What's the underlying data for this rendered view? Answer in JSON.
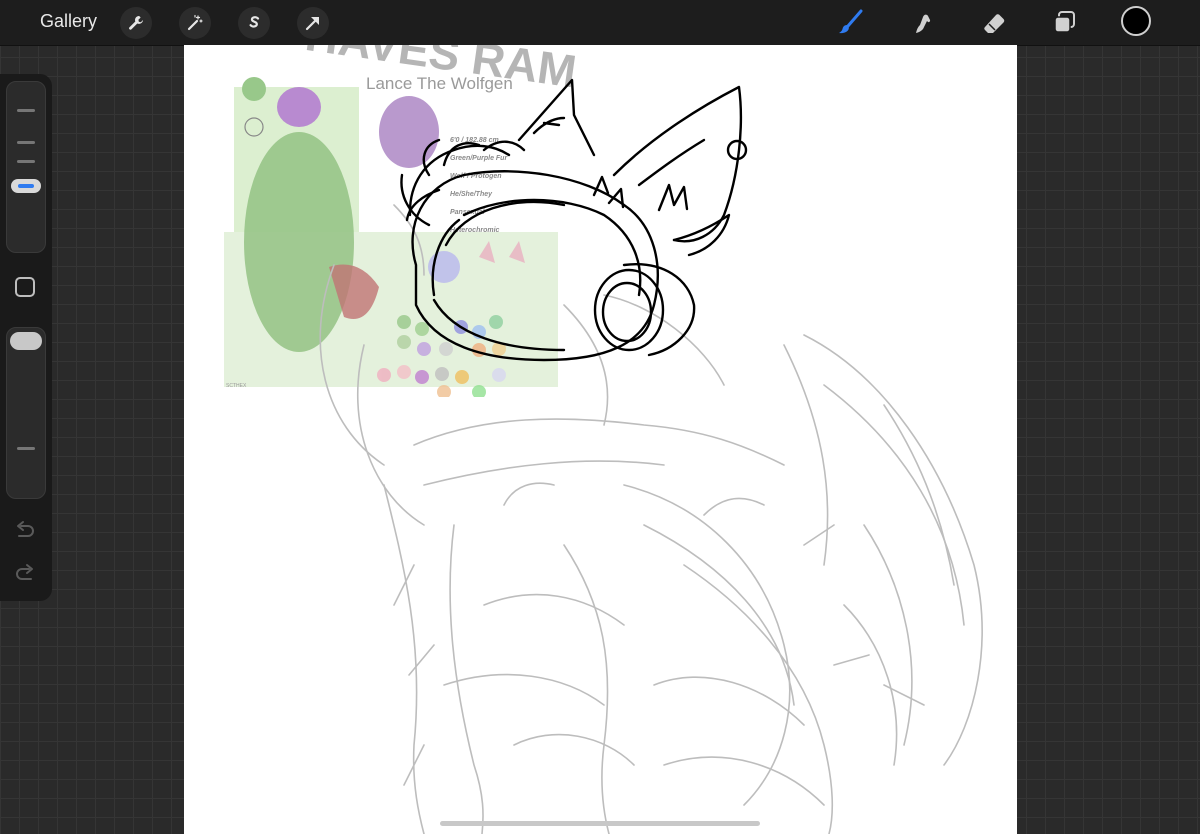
{
  "toolbar": {
    "gallery_label": "Gallery",
    "left_tools": [
      {
        "name": "wrench-icon"
      },
      {
        "name": "magic-wand-icon"
      },
      {
        "name": "selection-s-icon"
      },
      {
        "name": "transform-arrow-icon"
      }
    ],
    "right_tools": [
      {
        "name": "brush-icon",
        "active": true
      },
      {
        "name": "smudge-icon"
      },
      {
        "name": "eraser-icon"
      },
      {
        "name": "layers-icon"
      }
    ],
    "active_color": "#000000",
    "accent_color": "#2f7bf0"
  },
  "sidebar": {
    "brush_size_level": 0.25,
    "opacity_level": 0.95,
    "modify_button_icon": "square-icon",
    "undo_icon": "undo-icon",
    "redo_icon": "redo-icon"
  },
  "canvas": {
    "reference_sheet": {
      "title": "Lance The Wolfgen",
      "details": [
        "6'0 / 182.88 cm",
        "Green/Purple Fur",
        "Wolf / Protogen",
        "He/She/They",
        "Pansexual",
        "Heterochromic"
      ],
      "footer": "SCTHEX"
    },
    "watermark": "HAVES RAM"
  }
}
